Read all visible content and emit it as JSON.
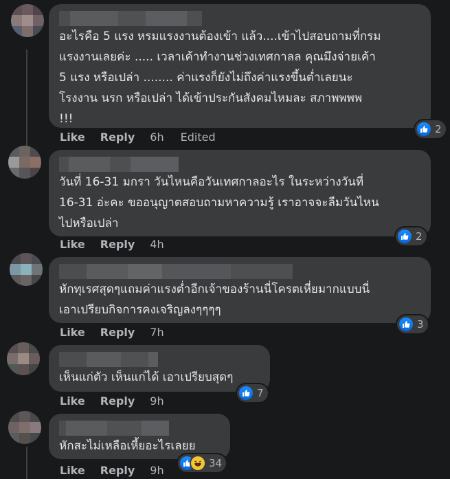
{
  "comments": [
    {
      "text": "อะไรคือ 5 แรง หรมแรงงานต้องเข้า แล้ว....เข้าไปสอบถามที่กรม\nแรงงานเลยค่ะ ..... เวลาเค้าทำงานช่วงเทศกาลล คุณมึงจ่ายเค้า\n5 แรง หรือเปล่า ........ ค่าแรงก็ยังไม่ถึงค่าแรงขึ้นต่ำเลยนะ\nโรงงาน นรก หรือเปล่า ได้เข้าประกันสังคมไหมละ สภาพพพพ\n!!!",
      "like_label": "Like",
      "reply_label": "Reply",
      "time": "6h",
      "edited": "Edited",
      "reaction_count": "2"
    },
    {
      "text": "วันที่ 16-31 มกรา วันไหนคือวันเทศกาลอะไร ในระหว่างวันที่\n16-31 อ่ะคะ ขออนุญาตสอบถามหาความรู้ เราอาจจะลืมวันไหน\nไปหรือเปล่า",
      "like_label": "Like",
      "reply_label": "Reply",
      "time": "4h",
      "reaction_count": "2"
    },
    {
      "text": "หักทุเรศสุดๆแถมค่าแรงต่ำอีกเจ้าของร้านนี่โครตเหี่ยมากแบบนี่\nเอาเปรียบกิจการคงเจริญลงๆๆๆๆ",
      "like_label": "Like",
      "reply_label": "Reply",
      "time": "7h",
      "reaction_count": "3"
    },
    {
      "text": "เห็นแก่ตัว เห็นแก่ได้ เอาเปรียบสุดๆ",
      "like_label": "Like",
      "reply_label": "Reply",
      "time": "9h",
      "reaction_count": "7"
    },
    {
      "text": "หักสะไม่เหลือเหี้ยอะไรเลยย",
      "like_label": "Like",
      "reply_label": "Reply",
      "time": "9h",
      "reaction_count": "34"
    }
  ],
  "colors": {
    "background": "#18191a",
    "bubble": "#3a3b3c",
    "text": "#e4e6eb",
    "secondary_text": "#b0b3b8",
    "like_blue": "#1877f2",
    "haha_yellow": "#f7c532"
  },
  "icons": [
    "like-reaction-icon",
    "haha-reaction-icon"
  ]
}
